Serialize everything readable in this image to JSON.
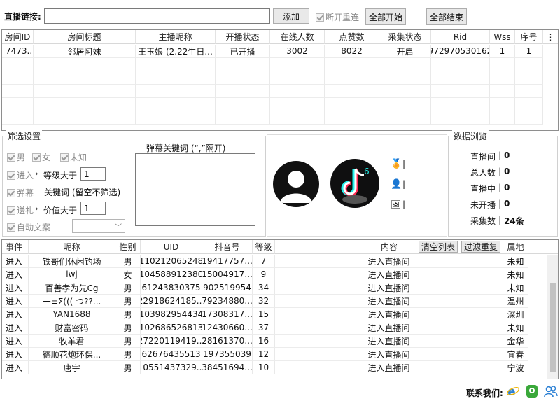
{
  "top": {
    "live_label": "直播链接:",
    "live_value": "",
    "add_label": "添加",
    "reconnect_label": "断开重连",
    "start_all_label": "全部开始",
    "end_all_label": "全部结束"
  },
  "rooms": {
    "headers": [
      "房间ID",
      "房间标题",
      "主播昵称",
      "开播状态",
      "在线人数",
      "点赞数",
      "采集状态",
      "Rid",
      "Wss",
      "序号"
    ],
    "rows": [
      [
        "7473...",
        "邻居阿妹",
        "王玉娘 (2.22生日...",
        "已开播",
        "3002",
        "8022",
        "开启",
        "972970530162",
        "1",
        "1"
      ]
    ]
  },
  "filters": {
    "title": "筛选设置",
    "male": "男",
    "female": "女",
    "unknown": "未知",
    "enter": "进入",
    "level_label": "等级大于",
    "level_value": "1",
    "danmu": "弹幕",
    "keyword_hint": "关键词 (留空不筛选)",
    "gift": "送礼",
    "value_label": "价值大于",
    "value_value": "1",
    "auto_copy": "自动文案",
    "danmu_keywords_title": "弹幕关键词 (“,”隔开)"
  },
  "profile": {
    "stat_marks": [
      "|",
      "|",
      "|"
    ]
  },
  "stats": {
    "title": "数据浏览",
    "items": [
      {
        "label": "直播间",
        "value": "0"
      },
      {
        "label": "总人数",
        "value": "0"
      },
      {
        "label": "直播中",
        "value": "0"
      },
      {
        "label": "未开播",
        "value": "0"
      },
      {
        "label": "采集数",
        "value": "24条"
      }
    ]
  },
  "events": {
    "headers": [
      "事件",
      "昵称",
      "性别",
      "UID",
      "抖音号",
      "等级",
      "内容",
      "属地"
    ],
    "clear_label": "清空列表",
    "reset_label": "过滤重复",
    "rows": [
      [
        "进入",
        "铁哥们休闲钓场",
        "男",
        "110212065248",
        "19417757...",
        "7",
        "进入直播间",
        "未知"
      ],
      [
        "进入",
        "lwj",
        "女",
        "104588912380",
        "15004917...",
        "9",
        "进入直播间",
        "未知"
      ],
      [
        "进入",
        "百善孝为先Cg",
        "男",
        "61243830375",
        "902519954",
        "34",
        "进入直播间",
        "未知"
      ],
      [
        "进入",
        "一≡Σ((( つ??...",
        "男",
        "22918624185...",
        "79234880...",
        "32",
        "进入直播间",
        "温州"
      ],
      [
        "进入",
        "YAN1688",
        "男",
        "103982954434",
        "17308317...",
        "15",
        "进入直播间",
        "深圳"
      ],
      [
        "进入",
        "财富密码",
        "男",
        "102686526813",
        "12430660...",
        "37",
        "进入直播间",
        "未知"
      ],
      [
        "进入",
        "牧羊君",
        "男",
        "27220119419...",
        "28161370...",
        "16",
        "进入直播间",
        "金华"
      ],
      [
        "进入",
        "德顺花炮环保...",
        "男",
        "62676435513",
        "197355039",
        "12",
        "进入直播间",
        "宜春"
      ],
      [
        "进入",
        "唐宇",
        "男",
        "10551437329...",
        "38451694...",
        "10",
        "进入直播间",
        "宁波"
      ]
    ]
  },
  "footer": {
    "contact_label": "联系我们:"
  },
  "colors": {
    "accent": "#2a7fd4",
    "green": "#3aa83a"
  }
}
